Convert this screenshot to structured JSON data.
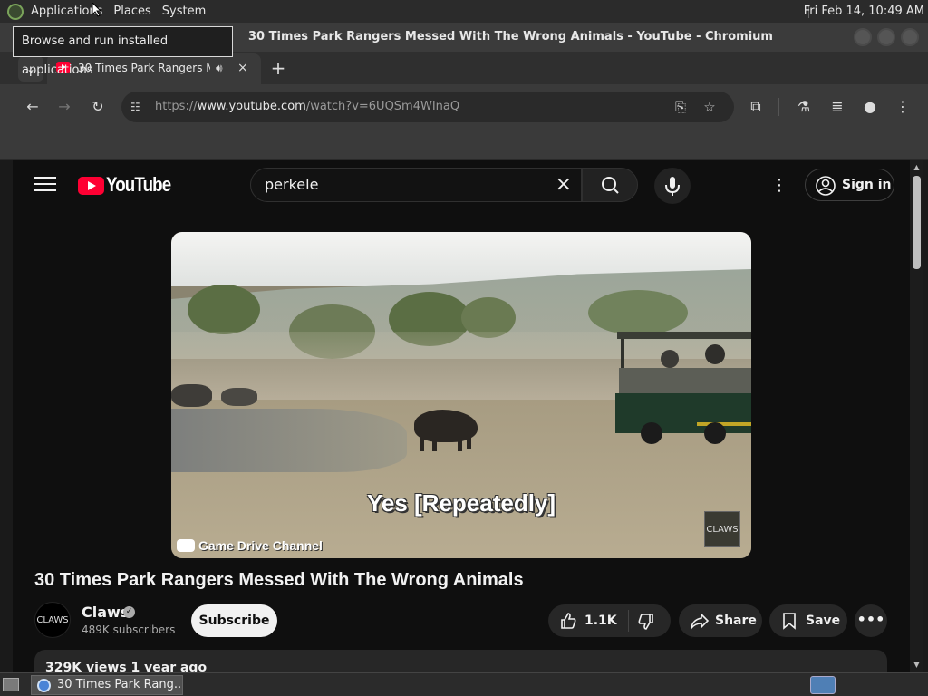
{
  "top_panel": {
    "menus": [
      "Applications",
      "Places",
      "System"
    ],
    "clock": "Fri Feb 14, 10:49 AM"
  },
  "tooltip": "Browse and run installed applications",
  "window": {
    "title": "30 Times Park Rangers Messed With The Wrong Animals - YouTube - Chromium"
  },
  "tab": {
    "title": "30 Times Park Rangers Messed With The Wrong Animals - YouTube",
    "audio_icon": "speaker-icon",
    "close": "×"
  },
  "new_tab": "+",
  "omnibox": {
    "scheme": "https://",
    "host": "www.youtube.com",
    "path": "/watch?v=6UQSm4WInaQ"
  },
  "youtube": {
    "logo_text": "YouTube",
    "search_value": "perkele",
    "search_clear": "×",
    "sign_in": "Sign in",
    "video": {
      "subtitle": "Yes [Repeatedly]",
      "channel_watermark": "Game Drive Channel",
      "logo_watermark": "CLAWS"
    },
    "title": "30 Times Park Rangers Messed With The Wrong Animals",
    "channel": {
      "name": "Claws",
      "avatar_text": "CLAWS",
      "subscribers": "489K subscribers"
    },
    "subscribe": "Subscribe",
    "likes": "1.1K",
    "share": "Share",
    "save": "Save",
    "description_meta": "329K views  1 year ago"
  },
  "taskbar": {
    "task_label": "30 Times Park Rang..."
  },
  "colors": {
    "youtube_red": "#ff0033",
    "page_bg": "#0f0f0f",
    "chip_bg": "#272727"
  }
}
